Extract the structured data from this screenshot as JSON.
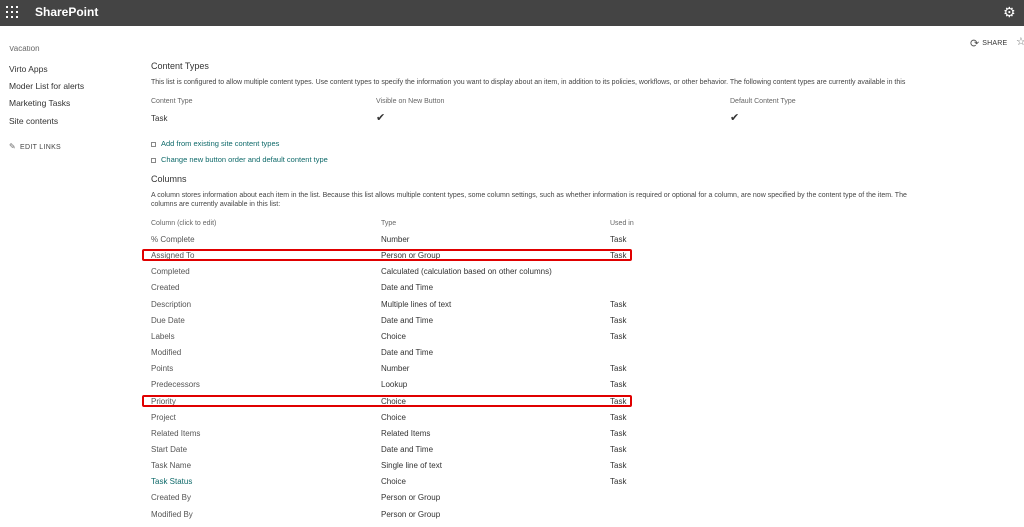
{
  "suitebar": {
    "brand": "SharePoint",
    "gear_icon": "gear-icon",
    "waffle_icon": "app-launcher-icon"
  },
  "sharebar": {
    "share_label": "SHARE",
    "share_icon": "sync-icon",
    "follow_icon": "star-icon"
  },
  "nav": {
    "cut_item": "Vacation",
    "items": [
      {
        "label": "Virto Apps"
      },
      {
        "label": "Moder List for alerts"
      },
      {
        "label": "Marketing Tasks"
      },
      {
        "label": "Site contents"
      }
    ],
    "edit_links": "EDIT LINKS"
  },
  "content_types": {
    "title": "Content Types",
    "description": "This list is configured to allow multiple content types. Use content types to specify the information you want to display about an item, in addition to its policies, workflows, or other behavior. The following content types are currently available in this",
    "headers": {
      "name": "Content Type",
      "visible": "Visible on New Button",
      "default": "Default Content Type"
    },
    "rows": [
      {
        "name": "Task",
        "visible": true,
        "default": true
      }
    ],
    "links": [
      {
        "label": "Add from existing site content types"
      },
      {
        "label": "Change new button order and default content type"
      }
    ]
  },
  "columns": {
    "title": "Columns",
    "description_line1": "A column stores information about each item in the list. Because this list allows multiple content types, some column settings, such as whether information is required or optional for a column, are now specified by the content type of the item. The",
    "description_line2": "columns are currently available in this list:",
    "headers": {
      "column": "Column (click to edit)",
      "type": "Type",
      "used_in": "Used in"
    },
    "rows": [
      {
        "column": "% Complete",
        "type": "Number",
        "used_in": "Task"
      },
      {
        "column": "Assigned To",
        "type": "Person or Group",
        "used_in": "Task",
        "highlighted": true
      },
      {
        "column": "Completed",
        "type": "Calculated (calculation based on other columns)",
        "used_in": ""
      },
      {
        "column": "Created",
        "type": "Date and Time",
        "used_in": ""
      },
      {
        "column": "Description",
        "type": "Multiple lines of text",
        "used_in": "Task"
      },
      {
        "column": "Due Date",
        "type": "Date and Time",
        "used_in": "Task"
      },
      {
        "column": "Labels",
        "type": "Choice",
        "used_in": "Task"
      },
      {
        "column": "Modified",
        "type": "Date and Time",
        "used_in": ""
      },
      {
        "column": "Points",
        "type": "Number",
        "used_in": "Task"
      },
      {
        "column": "Predecessors",
        "type": "Lookup",
        "used_in": "Task"
      },
      {
        "column": "Priority",
        "type": "Choice",
        "used_in": "Task",
        "highlighted": true
      },
      {
        "column": "Project",
        "type": "Choice",
        "used_in": "Task"
      },
      {
        "column": "Related Items",
        "type": "Related Items",
        "used_in": "Task"
      },
      {
        "column": "Start Date",
        "type": "Date and Time",
        "used_in": "Task"
      },
      {
        "column": "Task Name",
        "type": "Single line of text",
        "used_in": "Task"
      },
      {
        "column": "Task Status",
        "type": "Choice",
        "used_in": "Task",
        "link": true
      },
      {
        "column": "Created By",
        "type": "Person or Group",
        "used_in": ""
      },
      {
        "column": "Modified By",
        "type": "Person or Group",
        "used_in": ""
      }
    ]
  },
  "colors": {
    "suitebar": "#444444",
    "link": "#0f6a6a",
    "highlight": "#e00000"
  }
}
